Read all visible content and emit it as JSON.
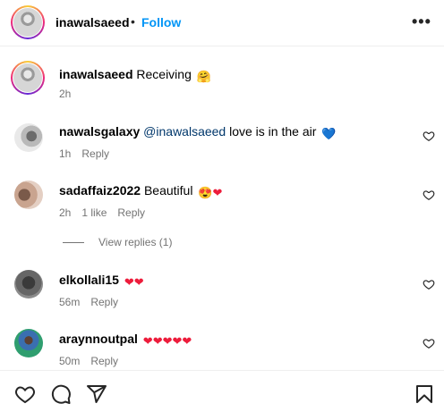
{
  "header": {
    "username": "inawalsaeed",
    "separator": "•",
    "follow_label": "Follow",
    "more_label": "•••"
  },
  "caption": {
    "username": "inawalsaeed",
    "text": "Receiving",
    "emoji": "🤗",
    "time": "2h"
  },
  "comments": [
    {
      "username": "nawalsgalaxy",
      "mention": "@inawalsaeed",
      "text": "love is in the air",
      "emoji": "💙",
      "time": "1h",
      "reply_label": "Reply"
    },
    {
      "username": "sadaffaiz2022",
      "text": "Beautiful",
      "emoji": "😍❤",
      "time": "2h",
      "likes": "1 like",
      "reply_label": "Reply",
      "view_replies": "View replies (1)"
    },
    {
      "username": "elkollali15",
      "text": "",
      "emoji": "❤❤",
      "time": "56m",
      "reply_label": "Reply"
    },
    {
      "username": "araynnoutpal",
      "text": "",
      "emoji": "❤❤❤❤❤",
      "time": "50m",
      "reply_label": "Reply"
    }
  ],
  "icons": {
    "like": "heart-icon",
    "comment": "comment-icon",
    "share": "share-icon",
    "save": "bookmark-icon"
  }
}
